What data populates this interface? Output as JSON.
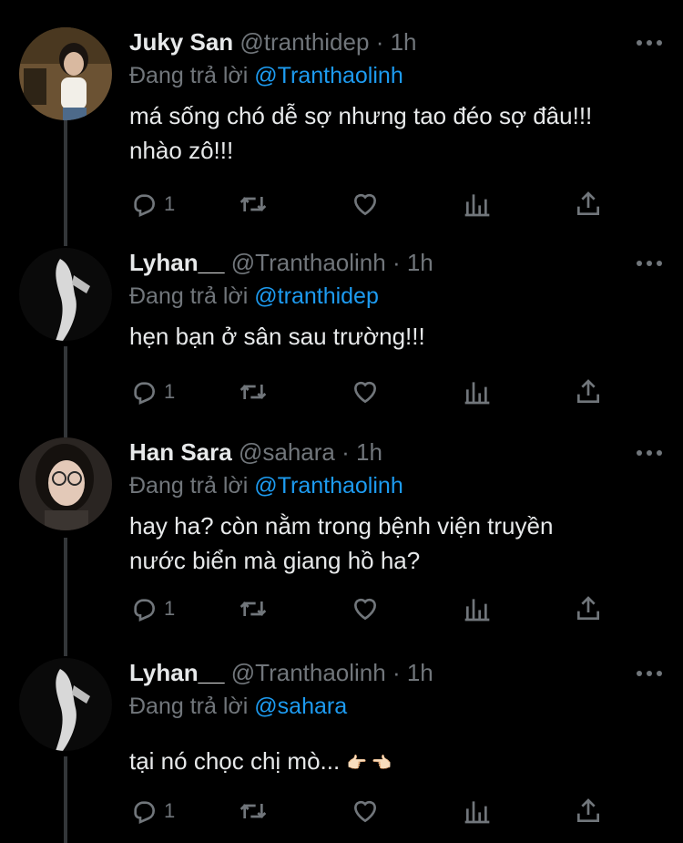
{
  "tweets": [
    {
      "name": "Juky San",
      "handle": "@tranthidep",
      "time": "· 1h",
      "reply_prefix": "Đang trả lời",
      "reply_to": "@Tranthaolinh",
      "text_lines": [
        "má sống chó dễ sợ nhưng tao đéo sợ đâu!!!",
        "nhào zô!!!"
      ],
      "reply_count": "1"
    },
    {
      "name": "Lyhan__",
      "handle": "@Tranthaolinh",
      "time": "· 1h",
      "reply_prefix": "Đang trả lời",
      "reply_to": "@tranthidep",
      "text_lines": [
        "hẹn bạn ở sân sau trường!!!"
      ],
      "reply_count": "1"
    },
    {
      "name": "Han Sara",
      "handle": "@sahara",
      "time": "· 1h",
      "reply_prefix": "Đang trả lời",
      "reply_to": "@Tranthaolinh",
      "text_lines": [
        "hay ha? còn nằm trong bệnh viện truyền",
        "nước biển mà giang hồ ha?"
      ],
      "reply_count": "1"
    },
    {
      "name": "Lyhan__",
      "handle": "@Tranthaolinh",
      "time": "· 1h",
      "reply_prefix": "Đang trả lời",
      "reply_to": "@sahara",
      "text_lines": [
        "tại nó chọc chị mò..."
      ],
      "emoji": "👉🏻 👈🏻",
      "reply_count": "1"
    }
  ],
  "icons": {
    "reply": "reply-icon",
    "retweet": "retweet-icon",
    "like": "heart-icon",
    "views": "views-icon",
    "share": "share-icon",
    "more": "more-icon"
  },
  "colors": {
    "background": "#000000",
    "text": "#e7e9ea",
    "muted": "#71767b",
    "link": "#1d9bf0",
    "thread_line": "#333639"
  }
}
